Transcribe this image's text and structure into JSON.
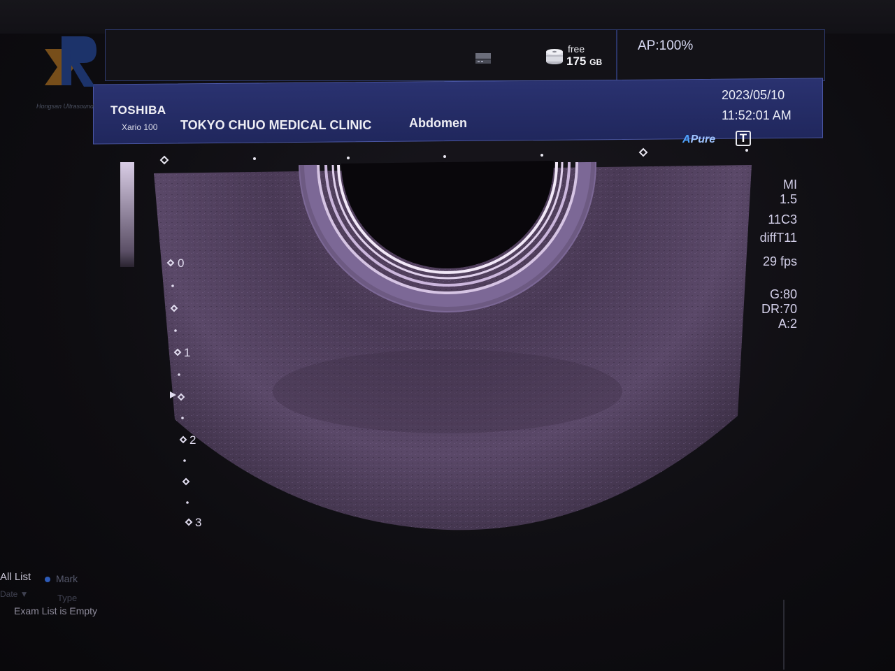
{
  "header": {
    "free_label": "free",
    "free_size": "175",
    "free_unit": "GB",
    "acoustic_power": "AP:100%"
  },
  "info_bar": {
    "brand": "TOSHIBA",
    "model": "Xario 100",
    "clinic": "TOKYO CHUO MEDICAL CLINIC",
    "preset": "Abdomen",
    "date": "2023/05/10",
    "time": "11:52:01 AM"
  },
  "watermark": "Hongsan Ultrasound",
  "image_mode": {
    "apure_a": "A",
    "apure_text": "Pure",
    "t_icon": "T"
  },
  "parameters": {
    "mi_label": "MI",
    "mi_value": "1.5",
    "probe": "11C3",
    "harmonic": "diffT11",
    "frame_rate": "29 fps",
    "gain": "G:80",
    "dynamic_range": "DR:70",
    "a_value": "A:2"
  },
  "depth_scale": [
    "0",
    "1",
    "2",
    "3"
  ],
  "exam_list": {
    "all_list": "All List",
    "mark": "Mark",
    "date_col": "Date ▼",
    "type_col": "Type",
    "empty_message": "Exam List is Empty"
  }
}
